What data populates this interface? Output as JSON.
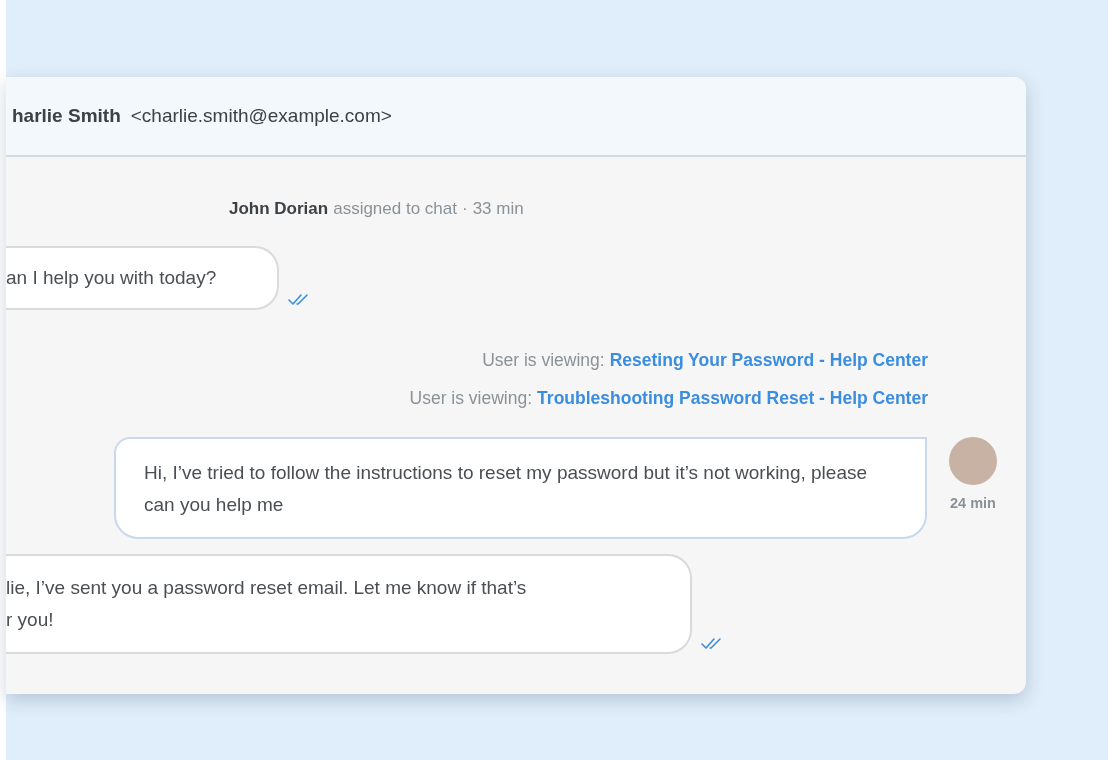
{
  "header": {
    "name": "harlie Smith",
    "email": "<charlie.smith@example.com>"
  },
  "messages": [
    {
      "kind": "system",
      "actor": "John Dorian",
      "action": "assigned to chat",
      "separator": "·",
      "time": "33 min"
    },
    {
      "kind": "agent",
      "text": "an I help you with today?",
      "read": true
    },
    {
      "kind": "viewing",
      "label": "User is viewing:",
      "link": "Reseting Your Password - Help Center"
    },
    {
      "kind": "viewing",
      "label": "User is viewing:",
      "link": "Troubleshooting Password Reset - Help Center"
    },
    {
      "kind": "user",
      "text": "Hi, I’ve tried to follow the instructions to reset my password but it’s not working, please can you help me",
      "time": "24 min"
    },
    {
      "kind": "agent",
      "text": "lie, I’ve sent you a password reset email. Let me know if that’s\nr you!",
      "read": true
    }
  ]
}
